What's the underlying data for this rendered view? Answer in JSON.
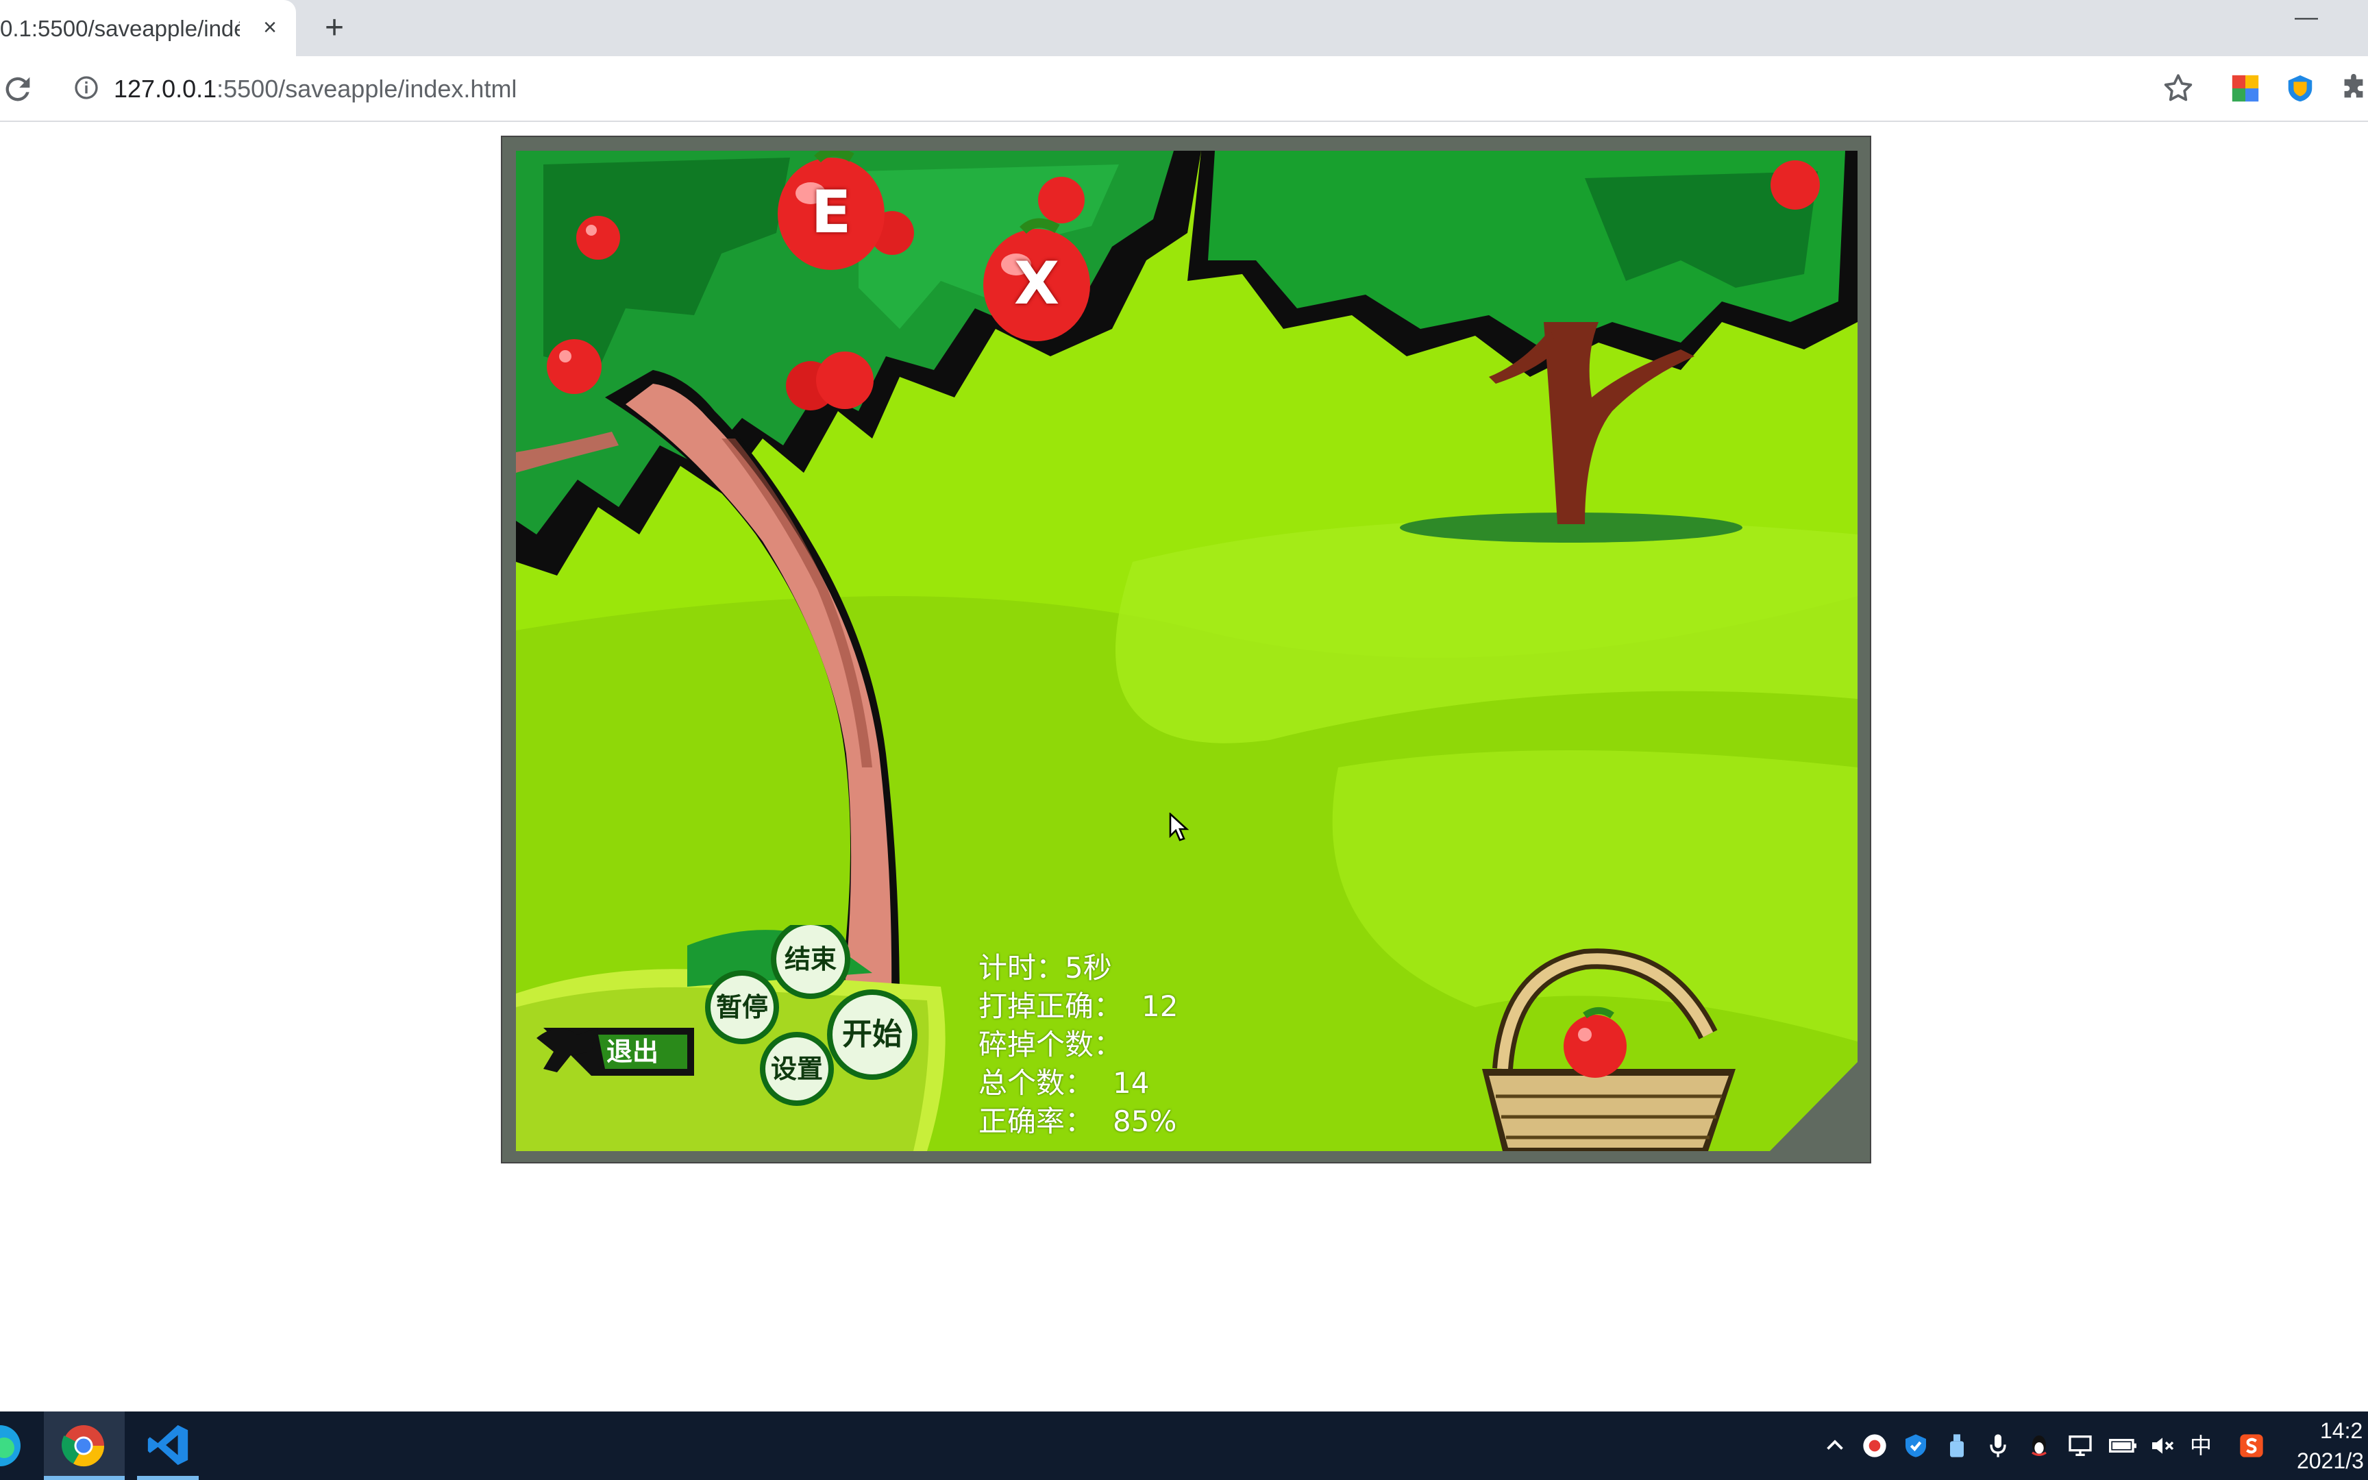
{
  "browser": {
    "tab_title": "0.1:5500/saveapple/indé",
    "tab_close": "×",
    "new_tab": "+",
    "minimize": "—",
    "url_host": "127.0.0.1",
    "url_path": ":5500/saveapple/index.html"
  },
  "game": {
    "falling_apples": [
      {
        "letter": "E"
      },
      {
        "letter": "X"
      }
    ],
    "stats": {
      "timer_label": "计时：",
      "timer_value": "5秒",
      "correct_label": "打掉正确：",
      "correct_value": "12",
      "broken_label": "碎掉个数：",
      "broken_value": "",
      "total_label": "总个数：",
      "total_value": "14",
      "accuracy_label": "正确率：",
      "accuracy_value": "85%"
    },
    "buttons": {
      "exit": "退出",
      "pause": "暂停",
      "end": "结束",
      "start": "开始",
      "settings": "设置"
    },
    "colors": {
      "sky_grass": "#9be60a",
      "frame": "#606a60",
      "apple": "#e82424"
    }
  },
  "taskbar": {
    "ime": "中",
    "time": "14:2",
    "date": "2021/3"
  }
}
